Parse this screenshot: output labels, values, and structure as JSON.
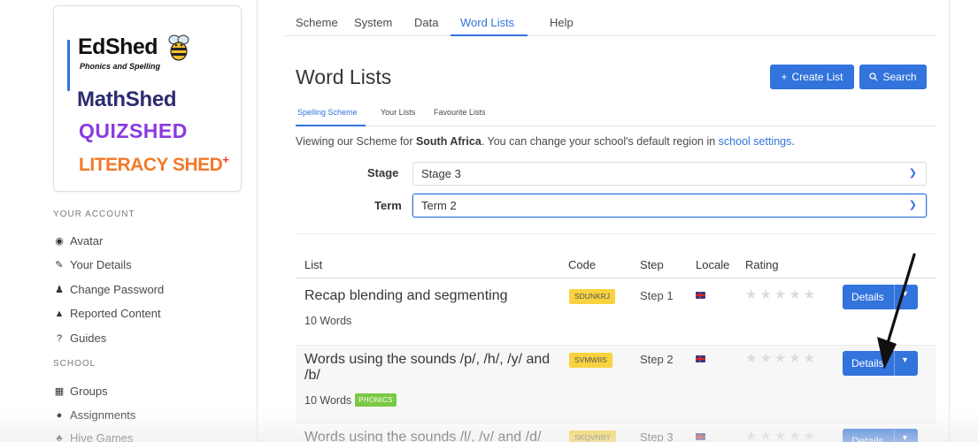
{
  "brand": {
    "edshed": "EdShed",
    "edshed_sub": "Phonics and Spelling",
    "mathshed": "MathShed",
    "quizshed": "QUIZSHED",
    "literacyshed": "LITERACY SHED",
    "literacyshed_plus": "+"
  },
  "sidebar": {
    "account_heading": "YOUR ACCOUNT",
    "account_items": [
      {
        "icon": "user-circle-icon",
        "label": "Avatar"
      },
      {
        "icon": "user-edit-icon",
        "label": "Your Details"
      },
      {
        "icon": "user-lock-icon",
        "label": "Change Password"
      },
      {
        "icon": "warning-icon",
        "label": "Reported Content"
      },
      {
        "icon": "question-icon",
        "label": "Guides"
      }
    ],
    "school_heading": "SCHOOL",
    "school_items": [
      {
        "icon": "grid-icon",
        "label": "Groups"
      },
      {
        "icon": "clock-icon",
        "label": "Assignments"
      },
      {
        "icon": "hive-icon",
        "label": "Hive Games"
      }
    ]
  },
  "topnav": {
    "tabs": [
      "Scheme",
      "System",
      "Data",
      "Word Lists",
      "Help"
    ],
    "active": "Word Lists"
  },
  "main": {
    "title": "Word Lists",
    "create_button": "Create List",
    "search_button": "Search",
    "subtabs": [
      "Spelling Scheme",
      "Your Lists",
      "Favourite Lists"
    ],
    "info": {
      "prefix": "Viewing our Scheme for ",
      "region": "South Africa",
      "middle": ". You can change your school's default region in ",
      "link": "school settings",
      "suffix": "."
    },
    "stage_label": "Stage",
    "stage_value": "Stage 3",
    "term_label": "Term",
    "term_value": "Term 2"
  },
  "table": {
    "headers": {
      "list": "List",
      "code": "Code",
      "step": "Step",
      "locale": "Locale",
      "rating": "Rating"
    },
    "details_label": "Details",
    "stars": "★★★★★",
    "rows": [
      {
        "title": "Recap blending and segmenting",
        "code": "SDUNKRJ",
        "step": "Step 1",
        "words": "10 Words",
        "tag": "",
        "rating": 0
      },
      {
        "title": "Words using the sounds /p/, /h/, /y/ and /b/",
        "code": "SVMWIIS",
        "step": "Step 2",
        "words": "10 Words",
        "tag": "PHONICS",
        "rating": 0
      },
      {
        "title": "Words using the sounds /l/, /v/ and /d/",
        "code": "SKQVNBY",
        "step": "Step 3",
        "words": "",
        "tag": "",
        "rating": 0
      }
    ]
  },
  "colors": {
    "accent": "#3273dc",
    "code_badge": "#f8d33f",
    "phonics_tag": "#7ac943"
  }
}
